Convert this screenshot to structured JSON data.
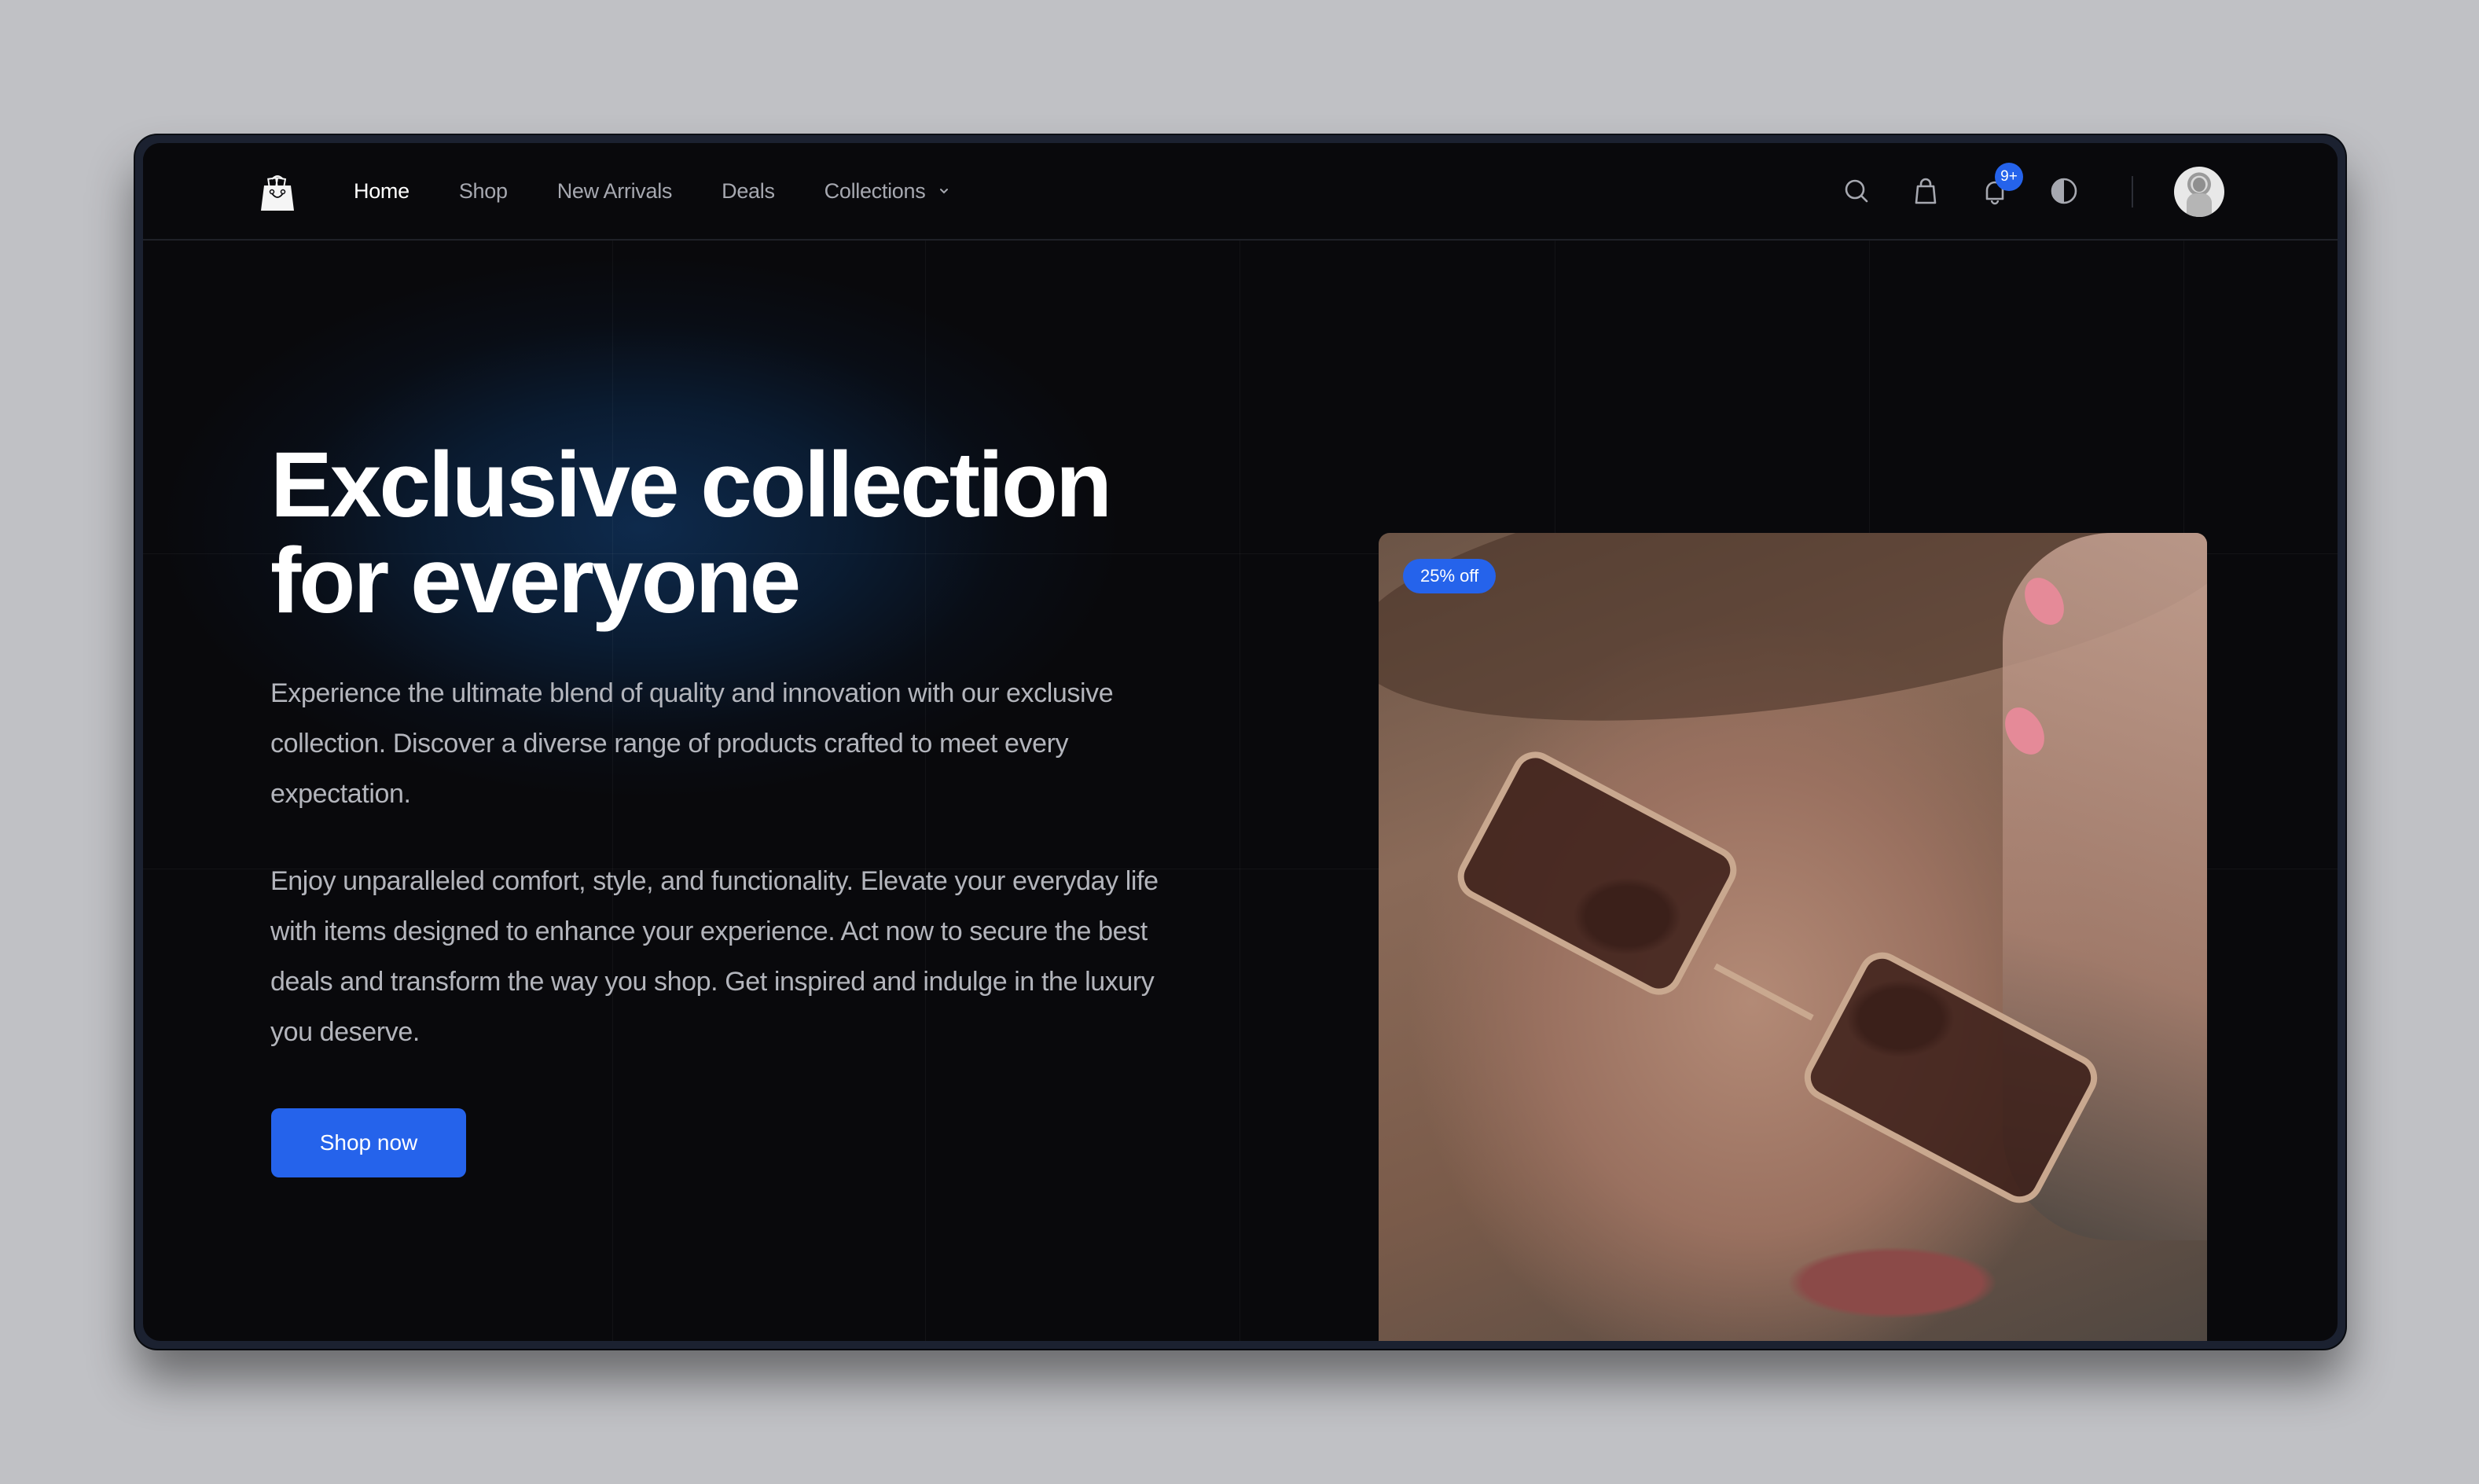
{
  "nav": {
    "logo_icon": "shopping-bag-smile-icon",
    "links": [
      {
        "label": "Home",
        "active": true
      },
      {
        "label": "Shop",
        "active": false
      },
      {
        "label": "New Arrivals",
        "active": false
      },
      {
        "label": "Deals",
        "active": false
      },
      {
        "label": "Collections",
        "active": false,
        "has_dropdown": true
      }
    ],
    "actions": {
      "search_icon": "search-icon",
      "cart_icon": "shopping-bag-icon",
      "notifications_icon": "bell-icon",
      "notifications_badge": "9+",
      "theme_icon": "contrast-icon",
      "avatar_icon": "user-avatar"
    }
  },
  "hero": {
    "headline": "Exclusive collection for everyone",
    "paragraph_1": "Experience the ultimate blend of quality and innovation with our exclusive collection. Discover a diverse range of products crafted to meet every expectation.",
    "paragraph_2": "Enjoy unparalleled comfort, style, and functionality. Elevate your everyday life with items designed to enhance your experience. Act now to secure the best deals and transform the way you shop. Get inspired and indulge in the luxury you deserve.",
    "cta_label": "Shop now",
    "image_badge": "25% off",
    "image_subject": "woman wearing tinted sunglasses"
  },
  "colors": {
    "accent": "#2563eb",
    "background": "#09090c",
    "text_primary": "#ffffff",
    "text_secondary": "#b3b5bc"
  }
}
